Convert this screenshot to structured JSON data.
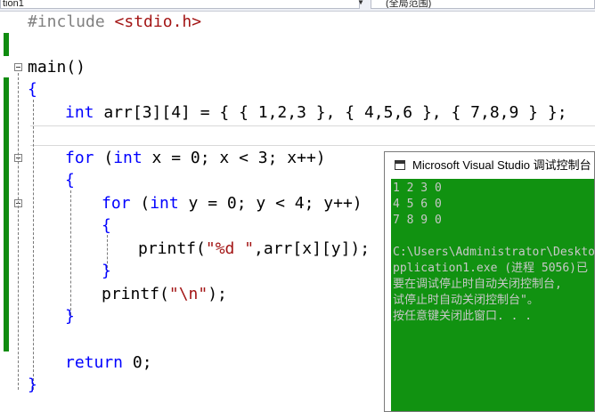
{
  "toolbar": {
    "project_dropdown": "tion1",
    "scope_dropdown": "(全局范围)"
  },
  "code": {
    "l1": "#include ",
    "l1_header": "<stdio.h>",
    "l3": "main()",
    "l4_brace": "{",
    "l5_kw": "int",
    "l5_rest": " arr[3][4] = { { 1,2,3 }, { 4,5,6 }, { 7,8,9 } };",
    "l7_for": "for",
    "l7_a": " (",
    "l7_int": "int",
    "l7_rest": " x = 0; x < 3; x++)",
    "l8_brace": "{",
    "l9_for": "for",
    "l9_a": " (",
    "l9_int": "int",
    "l9_rest": " y = 0; y < 4; y++)",
    "l10_brace": "{",
    "l11_fn": "printf(",
    "l11_str": "\"%d \"",
    "l11_rest": ",arr[x][y]);",
    "l12_brace": "}",
    "l13_fn": "printf(",
    "l13_str": "\"\\n\"",
    "l13_rest": ");",
    "l14_brace": "}",
    "l16_kw": "return",
    "l16_rest": " 0;",
    "l17_brace": "}"
  },
  "console": {
    "title": "Microsoft Visual Studio 调试控制台",
    "lines": [
      "1 2 3 0",
      "4 5 6 0",
      "7 8 9 0",
      "",
      "C:\\Users\\Administrator\\Deskto",
      "pplication1.exe (进程 5056)已",
      "要在调试停止时自动关闭控制台,",
      "试停止时自动关闭控制台\"。",
      "按任意键关闭此窗口. . ."
    ]
  },
  "colors": {
    "keyword": "#0000ff",
    "preprocessor": "#808080",
    "string": "#a31515",
    "change_margin": "#108c10",
    "console_background": "#119211"
  }
}
